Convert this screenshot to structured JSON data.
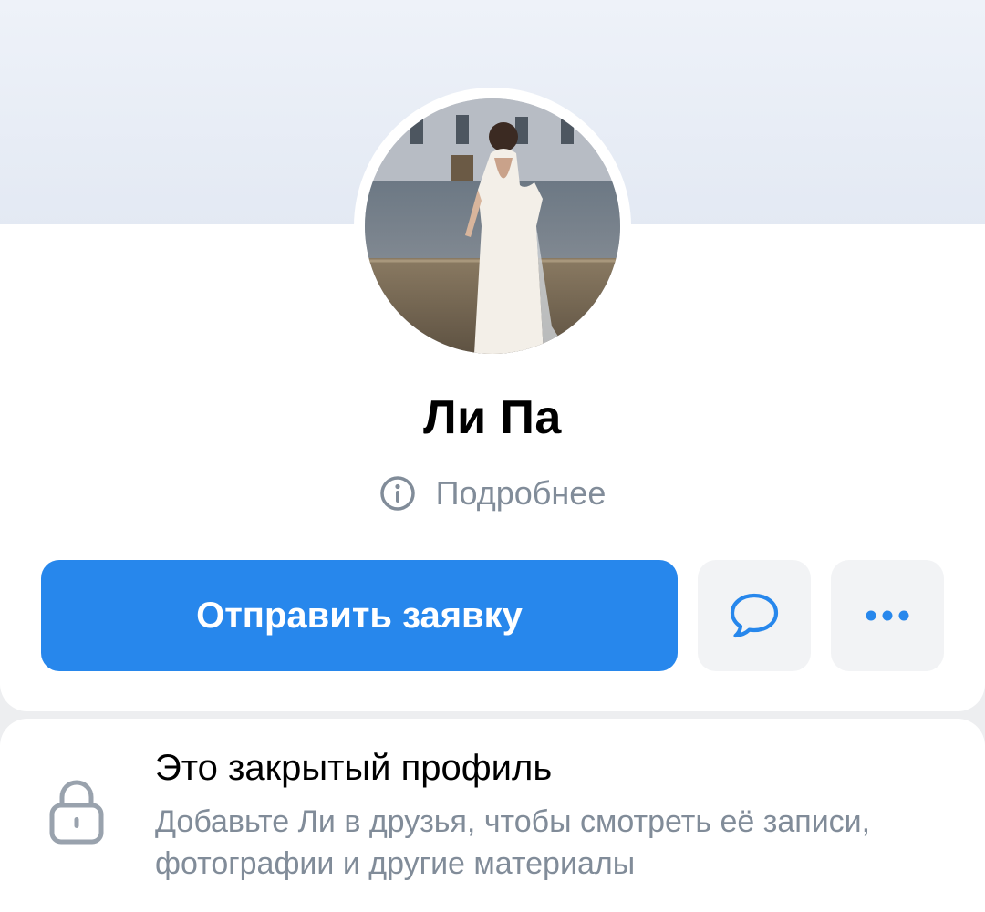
{
  "profile": {
    "name": "Ли Па",
    "details_label": "Подробнее"
  },
  "actions": {
    "primary_label": "Отправить заявку",
    "message_icon": "message-bubble-icon",
    "more_icon": "more-horizontal-icon"
  },
  "private_notice": {
    "title": "Это закрытый профиль",
    "description": "Добавьте Ли в друзья, чтобы смотреть её записи, фотографии и другие материалы",
    "icon": "lock-icon"
  },
  "colors": {
    "accent": "#2787ec",
    "secondary_text": "#818c99",
    "icon_button_bg": "#f2f3f5"
  }
}
